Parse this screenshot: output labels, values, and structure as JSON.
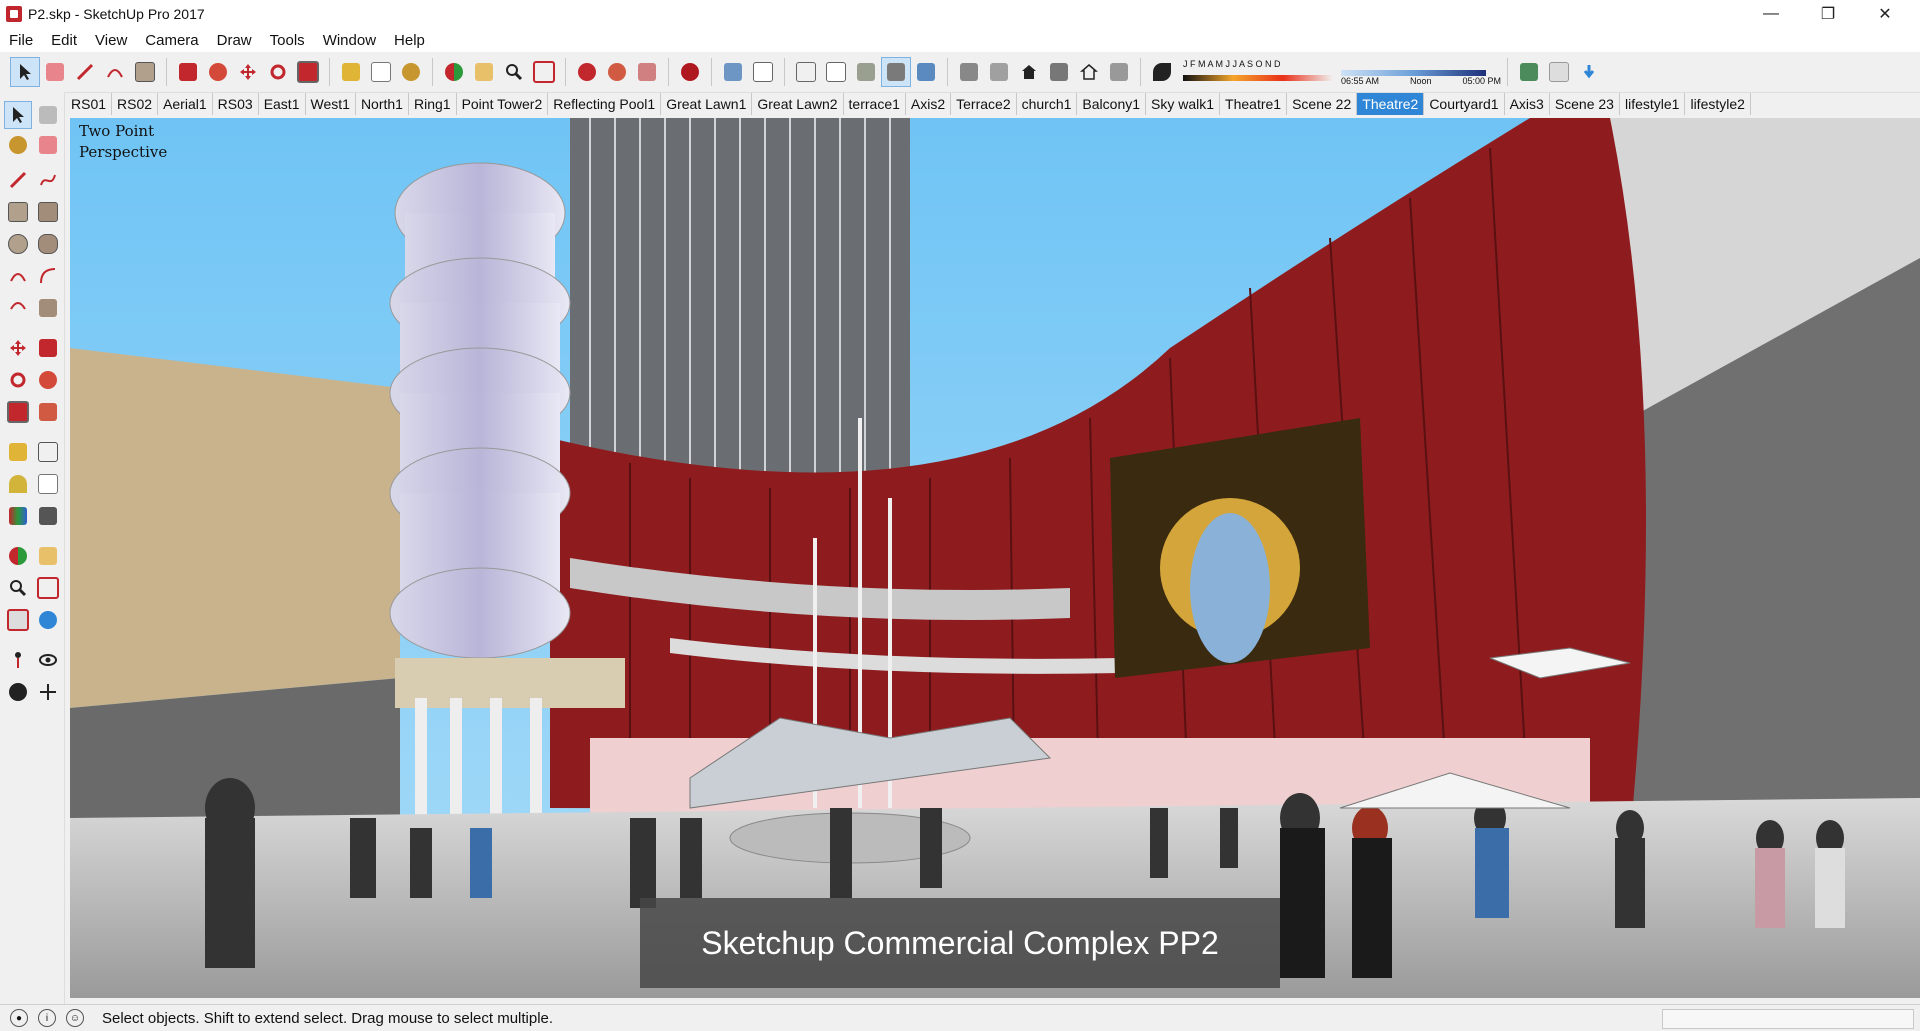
{
  "window": {
    "title": "P2.skp - SketchUp Pro 2017",
    "min_icon": "minimize-icon",
    "max_icon": "restore-icon",
    "close_icon": "close-icon"
  },
  "menu": [
    "File",
    "Edit",
    "View",
    "Camera",
    "Draw",
    "Tools",
    "Window",
    "Help"
  ],
  "toolbar": {
    "tools": [
      "select-icon",
      "eraser-icon",
      "line-icon",
      "arc-icon",
      "rectangle-icon",
      "push-pull-icon",
      "follow-me-icon",
      "move-icon",
      "rotate-icon",
      "scale-icon",
      "tape-measure-icon",
      "text-icon",
      "paint-bucket-icon",
      "orbit-icon",
      "pan-icon",
      "zoom-icon",
      "zoom-extents-icon",
      "warehouse-icon",
      "extension-icon",
      "styles-icon",
      "xray-icon",
      "back-edges-icon",
      "wireframe-icon",
      "hidden-line-icon",
      "shaded-icon",
      "shaded-textures-icon",
      "monochrome-icon",
      "iso-view-icon",
      "top-view-icon",
      "front-view-icon",
      "right-view-icon",
      "back-view-icon",
      "left-view-icon",
      "shadows-icon"
    ],
    "shadow_months": "J F M A M J J A S O N D",
    "shadow_time_start": "06:55 AM",
    "shadow_time_mid": "Noon",
    "shadow_time_end": "05:00 PM"
  },
  "scene_tabs": [
    {
      "label": "RS01"
    },
    {
      "label": "RS02"
    },
    {
      "label": "Aerial1"
    },
    {
      "label": "RS03"
    },
    {
      "label": "East1"
    },
    {
      "label": "West1"
    },
    {
      "label": "North1"
    },
    {
      "label": "Ring1"
    },
    {
      "label": "Point Tower2"
    },
    {
      "label": "Reflecting Pool1"
    },
    {
      "label": "Great Lawn1"
    },
    {
      "label": "Great Lawn2"
    },
    {
      "label": "terrace1"
    },
    {
      "label": "Axis2"
    },
    {
      "label": "Terrace2"
    },
    {
      "label": "church1"
    },
    {
      "label": "Balcony1"
    },
    {
      "label": "Sky walk1"
    },
    {
      "label": "Theatre1"
    },
    {
      "label": "Scene 22"
    },
    {
      "label": "Theatre2",
      "active": true
    },
    {
      "label": "Courtyard1"
    },
    {
      "label": "Axis3"
    },
    {
      "label": "Scene 23"
    },
    {
      "label": "lifestyle1"
    },
    {
      "label": "lifestyle2"
    }
  ],
  "viewport": {
    "label_line1": "Two Point",
    "label_line2": "Perspective",
    "caption": "Sketchup Commercial Complex PP2"
  },
  "status": {
    "text": "Select objects. Shift to extend select. Drag mouse to select multiple."
  }
}
